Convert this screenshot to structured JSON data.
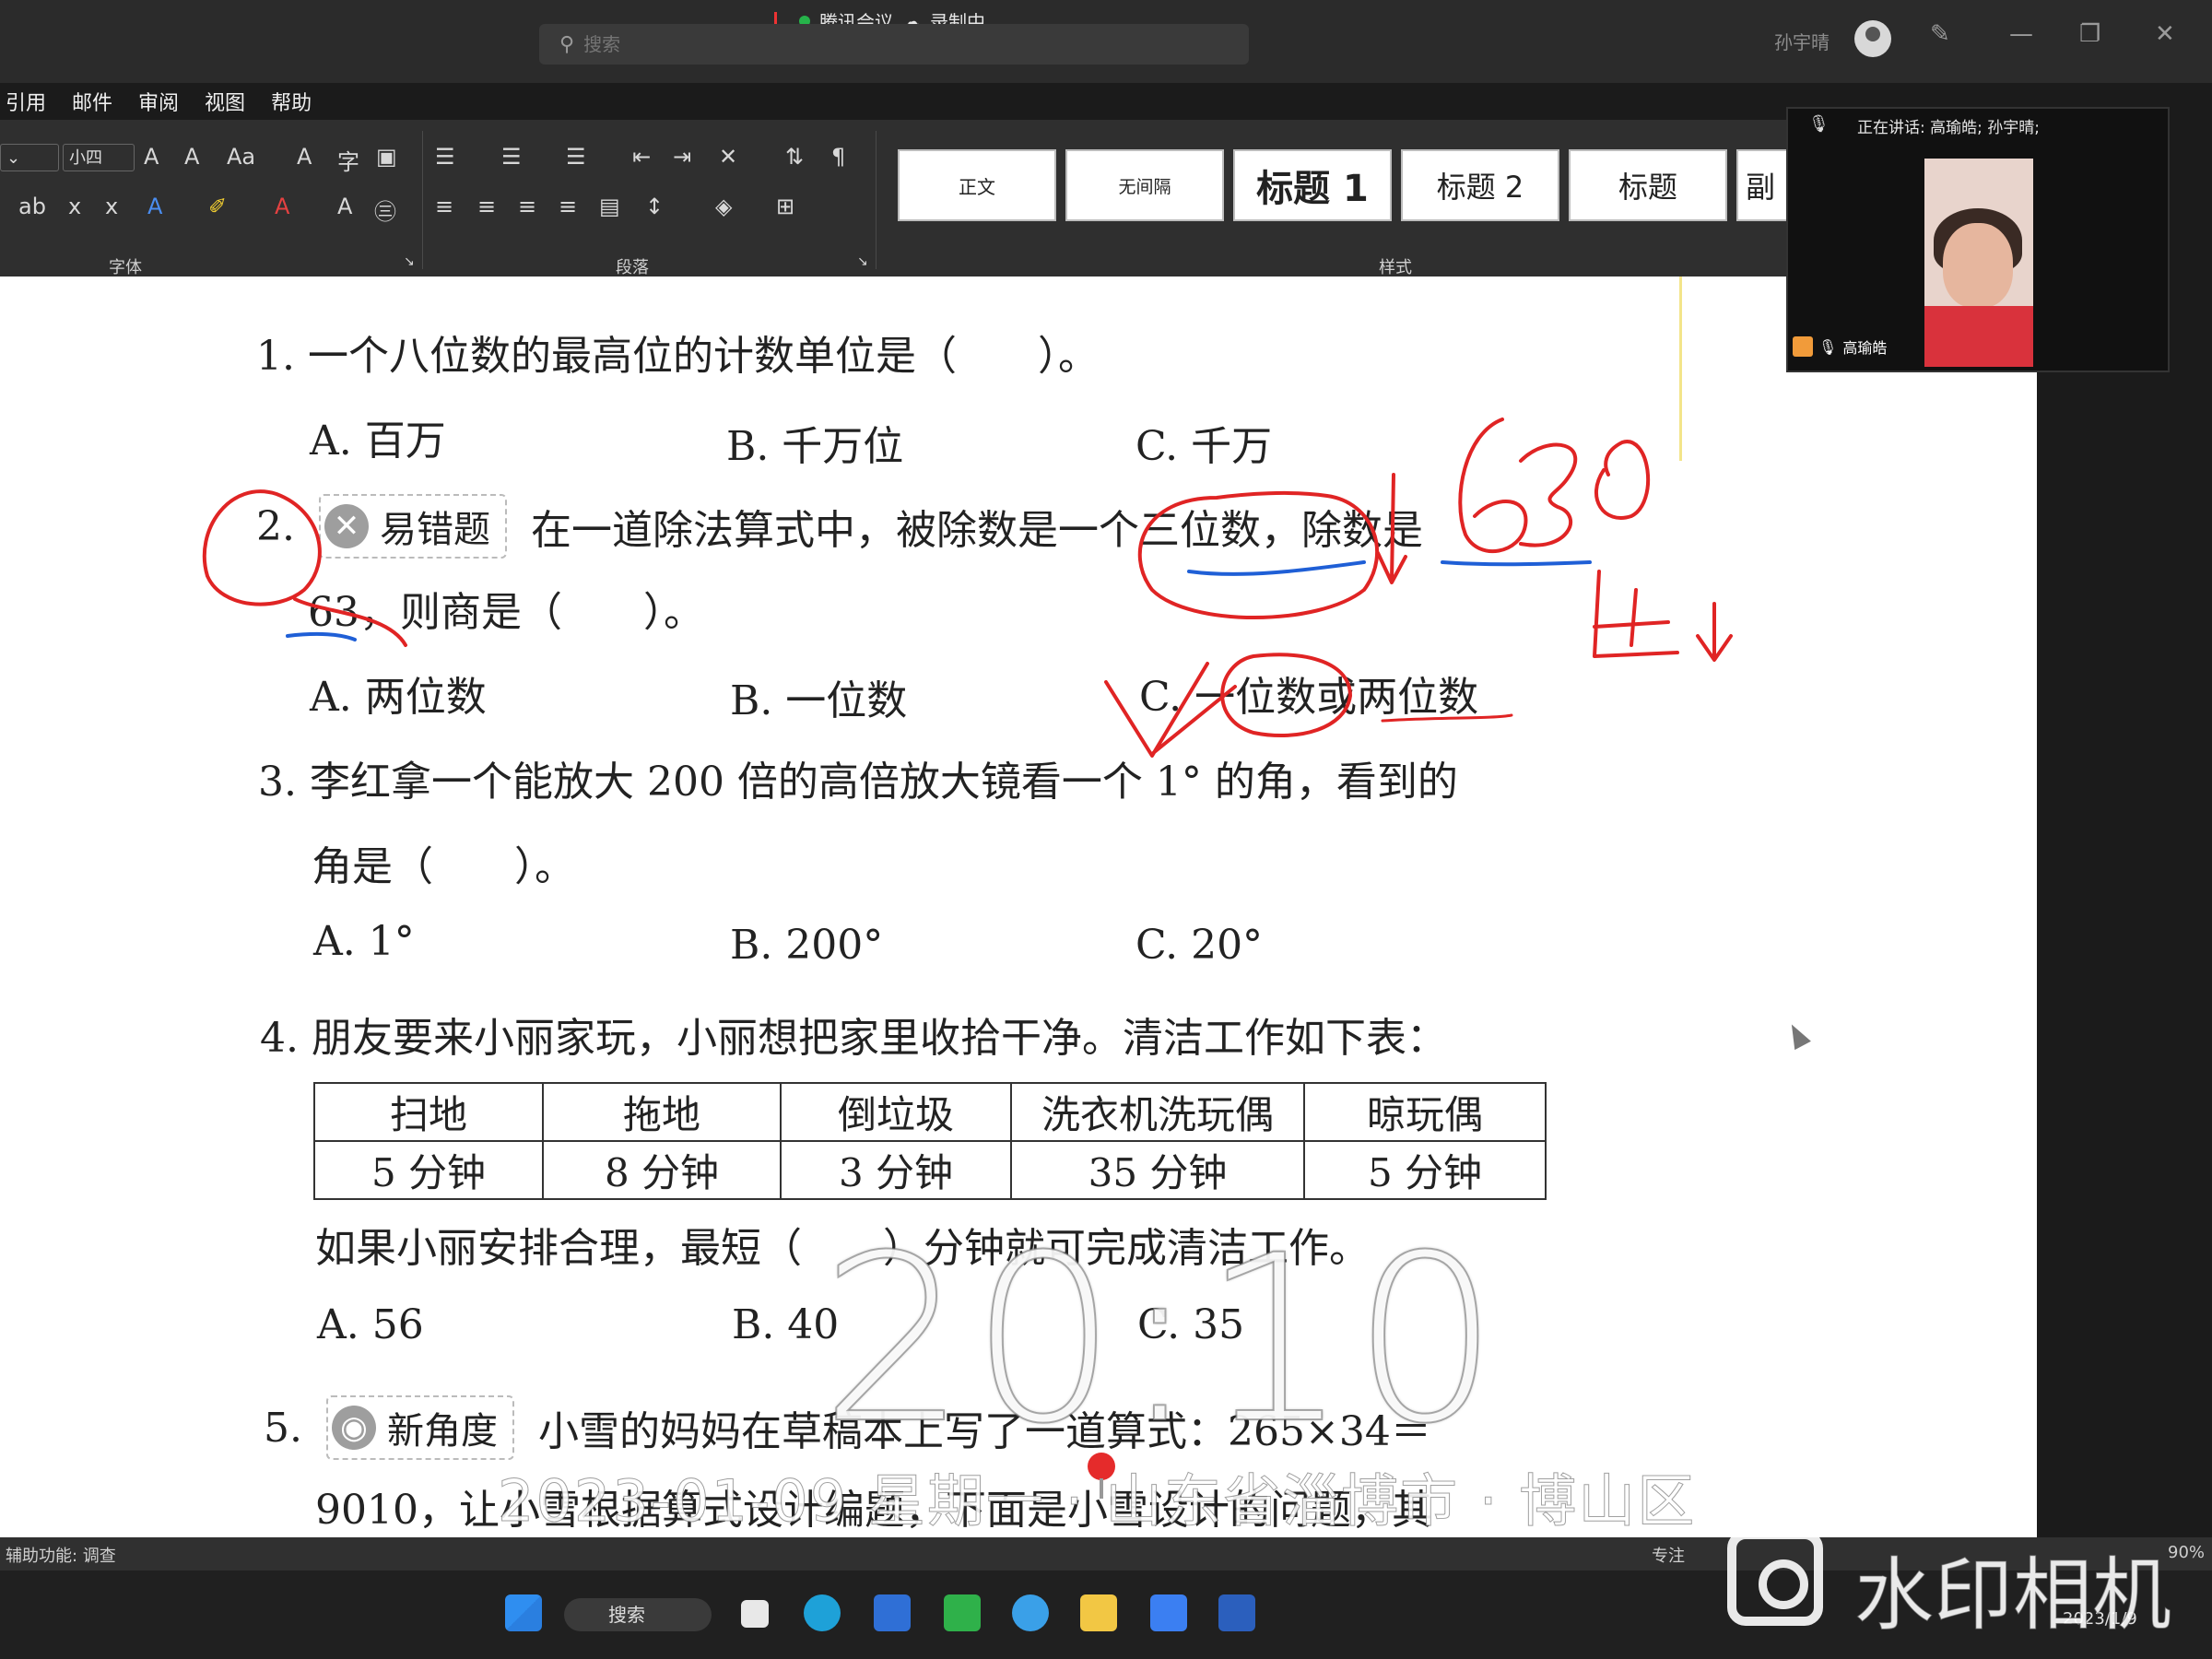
{
  "meeting": {
    "app_name": "腾讯会议",
    "recording_label": "录制中"
  },
  "search": {
    "placeholder": "搜索"
  },
  "user": {
    "name": "孙宇晴"
  },
  "ribbon": {
    "tabs": [
      "引用",
      "邮件",
      "审阅",
      "视图",
      "帮助"
    ],
    "font_size": "小四",
    "groups": {
      "font": "字体",
      "paragraph": "段落",
      "styles": "样式"
    },
    "styles": [
      {
        "label": "正文"
      },
      {
        "label": "无间隔"
      },
      {
        "label": "标题 1"
      },
      {
        "label": "标题 2"
      },
      {
        "label": "标题"
      },
      {
        "label": "副"
      }
    ]
  },
  "video": {
    "speaking_label": "正在讲话: 高瑜皓; 孙宇晴;",
    "participant_name": "高瑜皓"
  },
  "document": {
    "q1": {
      "text": "1. 一个八位数的最高位的计数单位是（　　）。",
      "options": [
        "A. 百万",
        "B. 千万位",
        "C. 千万"
      ]
    },
    "q2": {
      "num": "2.",
      "tag": "易错题",
      "line1": "在一道除法算式中，被除数是一个三位数，除数是",
      "line2": "63，则商是（　　）。",
      "options": [
        "A. 两位数",
        "B. 一位数",
        "C. 一位数或两位数"
      ]
    },
    "q3": {
      "line1": "3. 李红拿一个能放大 200 倍的高倍放大镜看一个 1° 的角，看到的",
      "line2": "角是（　　）。",
      "options": [
        "A. 1°",
        "B. 200°",
        "C. 20°"
      ]
    },
    "q4": {
      "line1": "4. 朋友要来小丽家玩，小丽想把家里收拾干净。清洁工作如下表：",
      "table_headers": [
        "扫地",
        "拖地",
        "倒垃圾",
        "洗衣机洗玩偶",
        "晾玩偶"
      ],
      "table_values": [
        "5 分钟",
        "8 分钟",
        "3 分钟",
        "35 分钟",
        "5 分钟"
      ],
      "line2": "如果小丽安排合理，最短（　　）分钟就可完成清洁工作。",
      "options": [
        "A. 56",
        "B. 40",
        "C. 35"
      ]
    },
    "q5": {
      "num": "5.",
      "tag": "新角度",
      "line1": "小雪的妈妈在草稿本上写了一道算式：265×34＝",
      "line2": "9010，让小雪根据算式设计编题，下面是小雪设计的问题，其"
    }
  },
  "statusbar": {
    "accessibility": "辅助功能: 调查",
    "focus": "专注",
    "zoom": "90%"
  },
  "taskbar": {
    "search_label": "搜索",
    "date": "2023/1/9"
  },
  "overlay": {
    "time": "20:10",
    "date_location": "2023-01-09 星期一 · 山东省淄博市 · 博山区",
    "watermark": "水印相机"
  },
  "colors": {
    "ink_red": "#e02424",
    "ink_blue": "#1f5fd6",
    "ribbon_bg": "#2f2f2f"
  }
}
